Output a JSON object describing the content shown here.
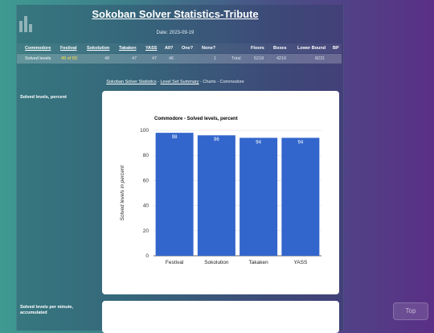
{
  "header": {
    "title_main": "Sokoban Solver Statistics",
    "title_suffix": "-Tribute",
    "date": "Date: 2023-09-19"
  },
  "table": {
    "headers": {
      "commodore": "Commodore",
      "festival": "Festival",
      "sokolution": "Sokolution",
      "takaken": "Takaken",
      "yass": "YASS",
      "all": "All?",
      "one": "One?",
      "none": "None?",
      "floors": "Floors",
      "boxes": "Boxes",
      "lower_bound": "Lower Bound",
      "bp": "BP"
    },
    "row": {
      "label": "Solved levels",
      "festival": "49 of 50",
      "sokolution": "48",
      "takaken": "47",
      "yass": "47",
      "all": "46",
      "none": "1",
      "total": "Total",
      "floors": "5218",
      "boxes": "4216",
      "lower_bound": "8231"
    }
  },
  "links": {
    "stats": "Sokoban Solver Statistics",
    "sep1": " - ",
    "summary": "Level Set Summary",
    "rest": " - Charts - Commodore"
  },
  "sections": {
    "solved_percent": "Solved levels, percent",
    "solved_per_minute": "Solved levels per minute, accumulated"
  },
  "chart_data": {
    "type": "bar",
    "title": "Commodore - Solved levels, percent",
    "ylabel": "Solved levels in percent",
    "xlabel": "",
    "categories": [
      "Festival",
      "Sokolution",
      "Takaken",
      "YASS"
    ],
    "values": [
      98,
      96,
      94,
      94
    ],
    "yticks": [
      0,
      20,
      40,
      60,
      80,
      100
    ],
    "ylim": [
      0,
      100
    ],
    "grid": true,
    "bar_color": "#3366cc"
  },
  "top_button": "Top"
}
